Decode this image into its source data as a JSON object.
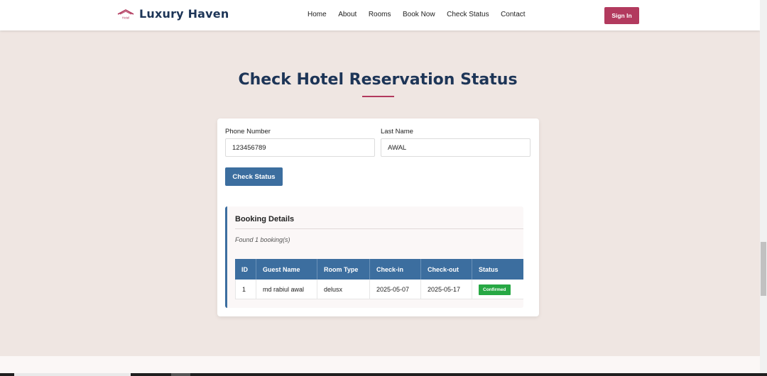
{
  "brand": {
    "logo_text": "Hotel",
    "name": "Luxury Haven"
  },
  "nav": {
    "links": [
      "Home",
      "About",
      "Rooms",
      "Book Now",
      "Check Status",
      "Contact"
    ],
    "signin_label": "Sign In"
  },
  "page": {
    "title": "Check Hotel Reservation Status"
  },
  "form": {
    "phone_label": "Phone Number",
    "phone_value": "123456789",
    "lastname_label": "Last Name",
    "lastname_value": "AWAL",
    "submit_label": "Check Status"
  },
  "results": {
    "title": "Booking Details",
    "found_text": "Found 1 booking(s)",
    "columns": [
      "ID",
      "Guest Name",
      "Room Type",
      "Check-in",
      "Check-out",
      "Status"
    ],
    "rows": [
      {
        "id": "1",
        "guest_name": "md rabiul awal",
        "room_type": "delusx",
        "check_in": "2025-05-07",
        "check_out": "2025-05-17",
        "status": "Confirmed"
      }
    ]
  },
  "colors": {
    "brand": "#1d3557",
    "accent": "#b23a5e",
    "primary": "#3c6e9f",
    "success": "#27a844",
    "background": "#efe6e2"
  }
}
